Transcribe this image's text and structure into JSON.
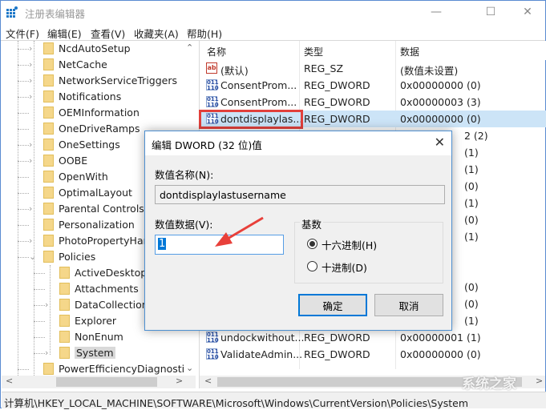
{
  "window": {
    "title": "注册表编辑器",
    "controls": {
      "minimize": "—",
      "maximize": "☐",
      "close": "✕"
    }
  },
  "menu": [
    "文件(F)",
    "编辑(E)",
    "查看(V)",
    "收藏夹(A)",
    "帮助(H)"
  ],
  "tree": {
    "items": [
      {
        "label": "NcdAutoSetup",
        "expandable": true,
        "level": 0
      },
      {
        "label": "NetCache",
        "expandable": true,
        "level": 0
      },
      {
        "label": "NetworkServiceTriggers",
        "expandable": true,
        "level": 0
      },
      {
        "label": "Notifications",
        "expandable": true,
        "level": 0
      },
      {
        "label": "OEMInformation",
        "expandable": false,
        "level": 0
      },
      {
        "label": "OneDriveRamps",
        "expandable": false,
        "level": 0
      },
      {
        "label": "OneSettings",
        "expandable": true,
        "level": 0
      },
      {
        "label": "OOBE",
        "expandable": true,
        "level": 0
      },
      {
        "label": "OpenWith",
        "expandable": false,
        "level": 0
      },
      {
        "label": "OptimalLayout",
        "expandable": false,
        "level": 0
      },
      {
        "label": "Parental Controls",
        "expandable": true,
        "level": 0
      },
      {
        "label": "Personalization",
        "expandable": false,
        "level": 0
      },
      {
        "label": "PhotoPropertyHan",
        "expandable": true,
        "level": 0
      },
      {
        "label": "Policies",
        "expandable": true,
        "expanded": true,
        "level": 0
      },
      {
        "label": "ActiveDesktop",
        "expandable": false,
        "level": 1
      },
      {
        "label": "Attachments",
        "expandable": false,
        "level": 1
      },
      {
        "label": "DataCollection",
        "expandable": true,
        "level": 1
      },
      {
        "label": "Explorer",
        "expandable": false,
        "level": 1
      },
      {
        "label": "NonEnum",
        "expandable": false,
        "level": 1
      },
      {
        "label": "System",
        "expandable": true,
        "level": 1,
        "selected": true
      },
      {
        "label": "PowerEfficiencyDiagnostics",
        "expandable": false,
        "level": 0
      }
    ]
  },
  "list": {
    "columns": [
      "名称",
      "类型",
      "数据"
    ],
    "rows": [
      {
        "icon": "ab",
        "name": "(默认)",
        "type": "REG_SZ",
        "data": "(数值未设置)"
      },
      {
        "icon": "bin",
        "name": "ConsentProm...",
        "type": "REG_DWORD",
        "data": "0x00000000 (0)"
      },
      {
        "icon": "bin",
        "name": "ConsentProm...",
        "type": "REG_DWORD",
        "data": "0x00000003 (3)"
      },
      {
        "icon": "bin",
        "name": "dontdisplaylas...",
        "type": "REG_DWORD",
        "data": "0x00000000 (0)",
        "selected": true
      },
      {
        "icon": "",
        "name": "",
        "type": "",
        "data": "2 (2)"
      },
      {
        "icon": "",
        "name": "",
        "type": "",
        "data": "(1)"
      },
      {
        "icon": "",
        "name": "",
        "type": "",
        "data": "(1)"
      },
      {
        "icon": "",
        "name": "",
        "type": "",
        "data": "(0)"
      },
      {
        "icon": "",
        "name": "",
        "type": "",
        "data": "(1)"
      },
      {
        "icon": "",
        "name": "",
        "type": "",
        "data": "(0)"
      },
      {
        "icon": "",
        "name": "",
        "type": "",
        "data": "(1)"
      },
      {
        "icon": "",
        "name": "",
        "type": "",
        "data": ""
      },
      {
        "icon": "",
        "name": "",
        "type": "",
        "data": ""
      },
      {
        "icon": "",
        "name": "",
        "type": "",
        "data": "(0)"
      },
      {
        "icon": "",
        "name": "",
        "type": "",
        "data": "(0)"
      },
      {
        "icon": "",
        "name": "",
        "type": "",
        "data": "(1)"
      },
      {
        "icon": "bin",
        "name": "undockwithout...",
        "type": "REG_DWORD",
        "data": "0x00000001 (1)"
      },
      {
        "icon": "bin",
        "name": "ValidateAdmin...",
        "type": "REG_DWORD",
        "data": "0x00000000 (0)"
      }
    ]
  },
  "status": {
    "path": "计算机\\HKEY_LOCAL_MACHINE\\SOFTWARE\\Microsoft\\Windows\\CurrentVersion\\Policies\\System"
  },
  "watermark": "系统之家",
  "dialog": {
    "title": "编辑 DWORD (32 位)值",
    "close": "✕",
    "name_label": "数值名称(N):",
    "name_value": "dontdisplaylastusername",
    "data_label": "数值数据(V):",
    "data_value": "1",
    "base_label": "基数",
    "base_options": [
      {
        "label": "十六进制(H)",
        "checked": true
      },
      {
        "label": "十进制(D)",
        "checked": false
      }
    ],
    "ok": "确定",
    "cancel": "取消"
  },
  "colors": {
    "highlight_box": "#e2403b",
    "selection": "#cce4f7",
    "accent": "#0078d7",
    "annotation_arrow": "#e8403a"
  }
}
